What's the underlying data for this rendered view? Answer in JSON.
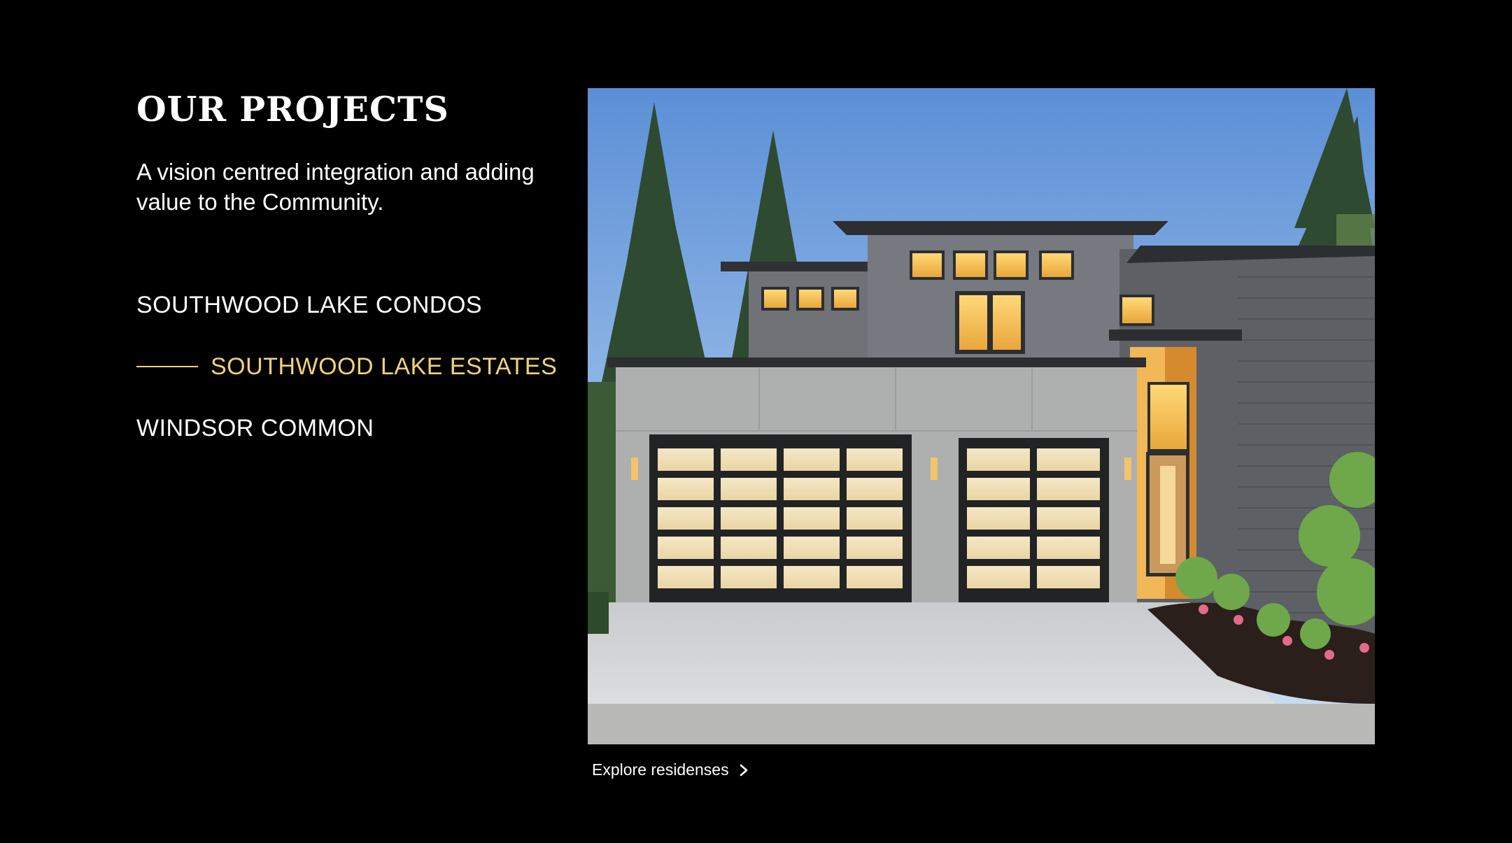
{
  "header": {
    "title": "OUR PROJECTS",
    "subtitle": "A vision centred integration and adding value to the Community."
  },
  "projects": {
    "items": [
      {
        "label": "SOUTHWOOD LAKE CONDOS",
        "active": false
      },
      {
        "label": "SOUTHWOOD LAKE ESTATES",
        "active": true
      },
      {
        "label": "WINDSOR COMMON",
        "active": false
      }
    ]
  },
  "cta": {
    "label": "Explore residenses",
    "icon": "chevron-right-icon"
  },
  "colors": {
    "background": "#000000",
    "text": "#ffffff",
    "accent": "#f1d27a"
  }
}
